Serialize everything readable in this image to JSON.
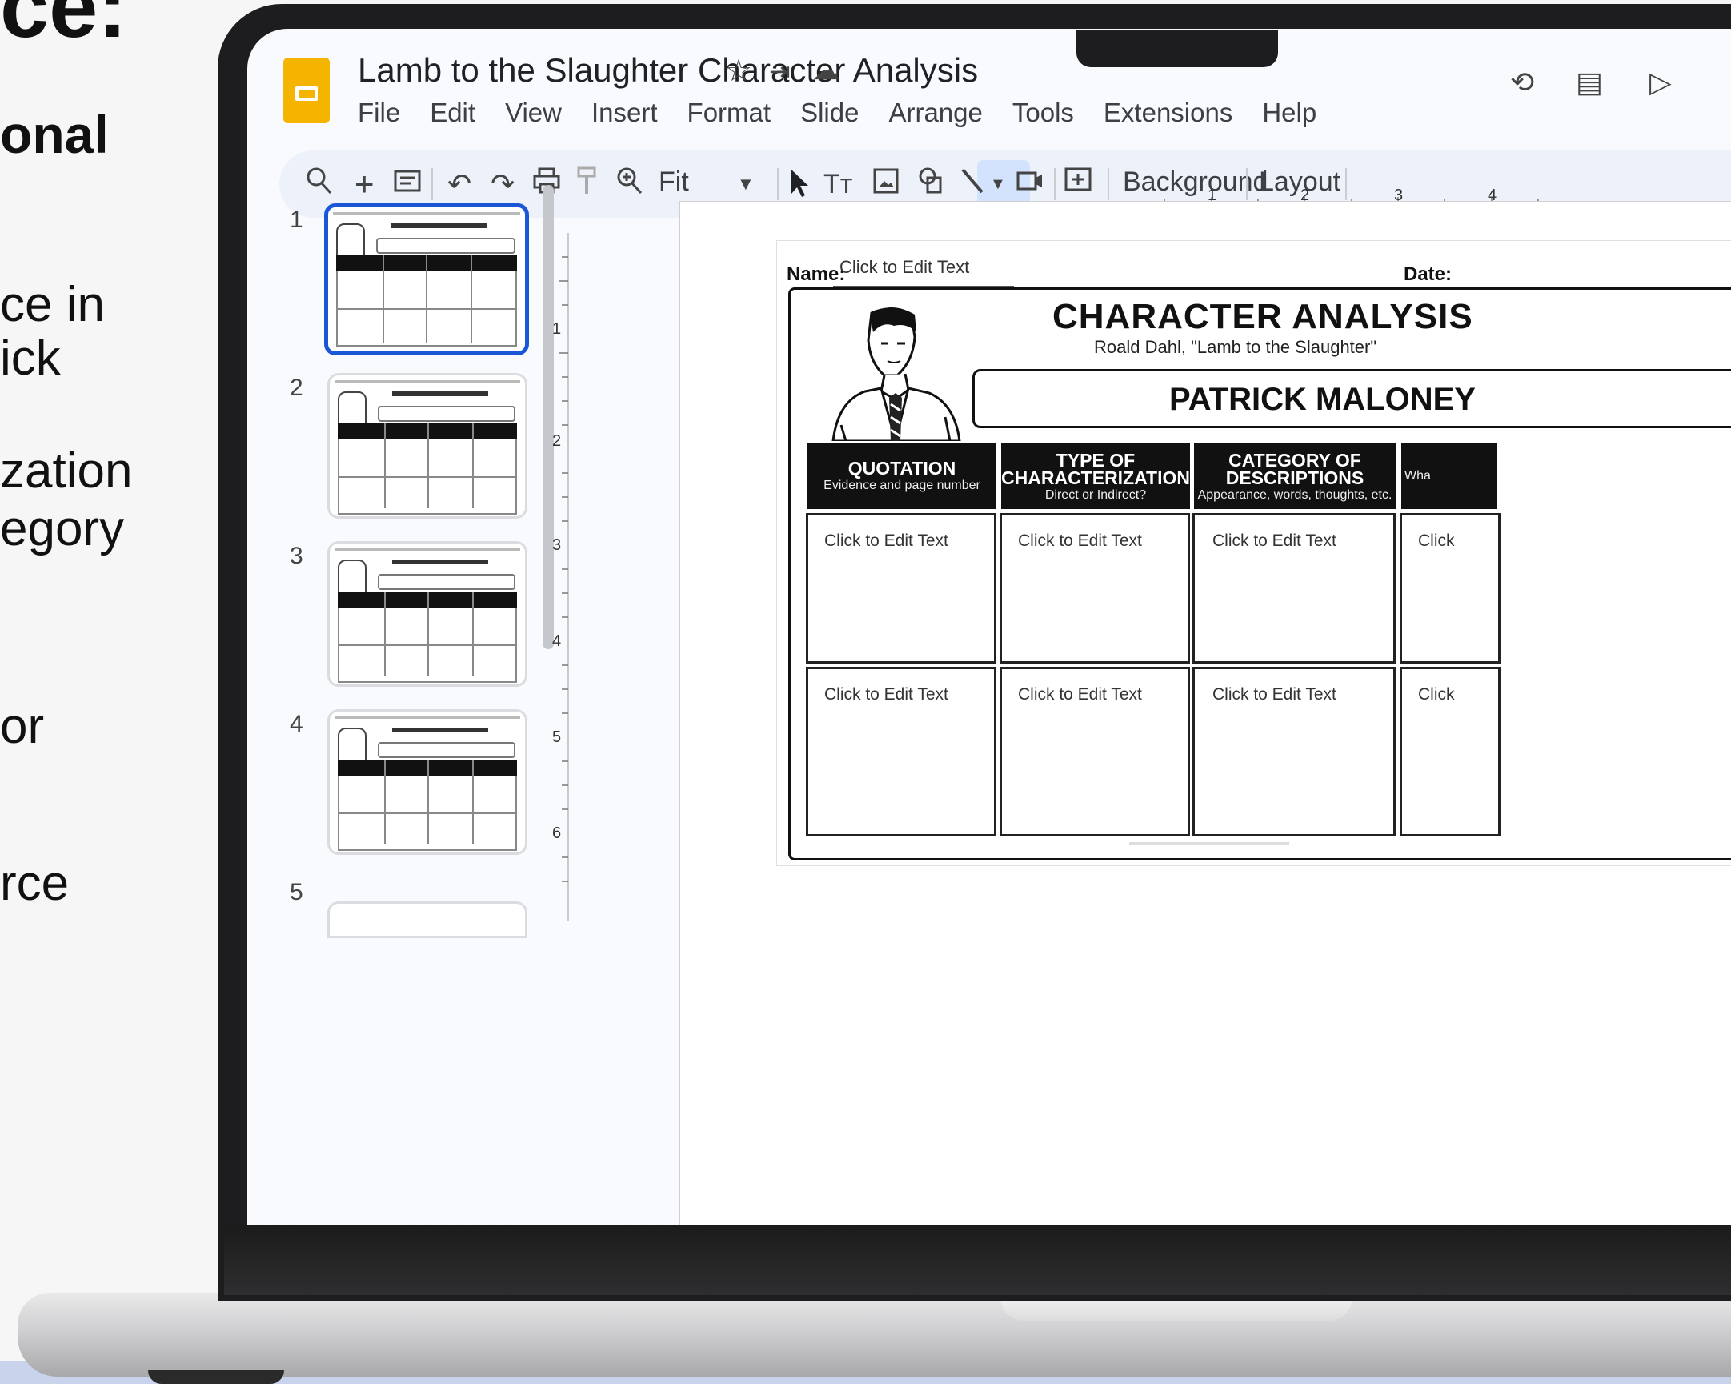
{
  "side_text": {
    "heading": "ce:",
    "bold_line": "onal",
    "lines": [
      "ce in",
      "ick",
      "zation",
      "egory",
      "or",
      "rce"
    ]
  },
  "app": {
    "doc_title": "Lamb to the Slaughter Character Analysis",
    "menu": [
      "File",
      "Edit",
      "View",
      "Insert",
      "Format",
      "Slide",
      "Arrange",
      "Tools",
      "Extensions",
      "Help"
    ],
    "title_icons": {
      "star": "☆",
      "move": "⇥",
      "cloud": "☁"
    },
    "right_icons": {
      "history": "⟲",
      "comments": "▤",
      "meet": "▷"
    }
  },
  "toolbar": {
    "zoom_label": "Fit",
    "background_label": "Background",
    "layout_label": "Layout"
  },
  "filmstrip": {
    "numbers": [
      "1",
      "2",
      "3",
      "4",
      "5"
    ]
  },
  "rulers": {
    "horizontal": [
      "1",
      "2",
      "3",
      "4"
    ],
    "vertical": [
      "1",
      "2",
      "3",
      "4",
      "5",
      "6"
    ]
  },
  "worksheet": {
    "name_label": "Name:",
    "name_value": "Click to Edit Text",
    "date_label": "Date:",
    "title": "CHARACTER ANALYSIS",
    "subtitle": "Roald Dahl, \"Lamb to the Slaughter\"",
    "character": "PATRICK MALONEY",
    "columns": [
      {
        "title": "QUOTATION",
        "sub": "Evidence and page number"
      },
      {
        "title": "TYPE OF CHARACTERIZATION",
        "sub": "Direct or Indirect?"
      },
      {
        "title": "CATEGORY OF DESCRIPTIONS",
        "sub": "Appearance, words, thoughts, etc."
      },
      {
        "title": "",
        "sub": "Wha"
      }
    ],
    "cell_text": "Click to Edit Text",
    "cell_text_partial": "Click"
  }
}
